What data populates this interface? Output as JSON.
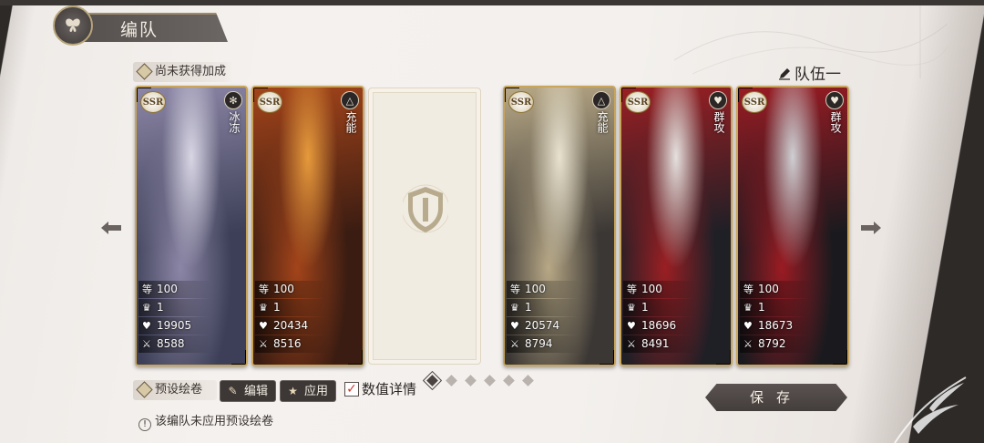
{
  "header": {
    "title": "编队"
  },
  "bonus_label": "尚未获得加成",
  "team_name": "队伍一",
  "left_cards": [
    {
      "rarity": "SSR",
      "type": "冰冻",
      "type_icon": "snowflake-icon",
      "level": "100",
      "rank": "1",
      "hp": "19905",
      "atk": "8588",
      "palette": [
        "#3c3f57",
        "#8c86a6",
        "#d8d6e4"
      ]
    },
    {
      "rarity": "SSR",
      "type": "充能",
      "type_icon": "triangle-icon",
      "level": "100",
      "rank": "1",
      "hp": "20434",
      "atk": "8516",
      "palette": [
        "#3a1c12",
        "#a3441a",
        "#e69a3c"
      ]
    }
  ],
  "right_cards": [
    {
      "rarity": "SSR",
      "type": "充能",
      "type_icon": "triangle-icon",
      "level": "100",
      "rank": "1",
      "hp": "20574",
      "atk": "8794",
      "palette": [
        "#3b3734",
        "#b7a886",
        "#e8e2cf"
      ]
    },
    {
      "rarity": "SSR",
      "type": "群攻",
      "type_icon": "heart-icon",
      "level": "100",
      "rank": "1",
      "hp": "18696",
      "atk": "8491",
      "palette": [
        "#1f1f26",
        "#9a1f23",
        "#e5e1de"
      ]
    },
    {
      "rarity": "SSR",
      "type": "群攻",
      "type_icon": "heart-icon",
      "level": "100",
      "rank": "1",
      "hp": "18673",
      "atk": "8792",
      "palette": [
        "#1a1a1e",
        "#9a1b23",
        "#cfcfd3"
      ]
    }
  ],
  "preset": {
    "label": "预设绘卷",
    "edit": "编辑",
    "apply": "应用"
  },
  "value_details": {
    "label": "数值详情",
    "checked": true
  },
  "pagination": {
    "count": 6,
    "active": 0
  },
  "save_label": "保存",
  "warning": "该编队未应用预设绘卷",
  "colors": {
    "gold": "#c9a55c",
    "dark": "#3d3735",
    "check": "#d0372f"
  }
}
